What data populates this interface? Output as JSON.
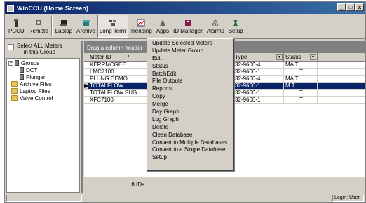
{
  "window": {
    "title": "WinCCU   (Home Screen)",
    "controls": [
      "_",
      "□",
      "x"
    ]
  },
  "toolbar": {
    "buttons": [
      {
        "label": "PCCU",
        "icon": "pccu-icon"
      },
      {
        "label": "Remote",
        "icon": "remote-icon"
      },
      {
        "label": "Laptop",
        "icon": "laptop-icon"
      },
      {
        "label": "Archive",
        "icon": "archive-icon"
      },
      {
        "label": "Long Term",
        "icon": "long-term-icon"
      },
      {
        "label": "Trending",
        "icon": "trending-icon"
      },
      {
        "label": "Apps",
        "icon": "apps-icon"
      },
      {
        "label": "ID Manager",
        "icon": "id-manager-icon"
      },
      {
        "label": "Alarms",
        "icon": "alarms-icon"
      },
      {
        "label": "Setup",
        "icon": "setup-icon"
      }
    ]
  },
  "sidebar": {
    "select_all_line1": "Select ALL Meters",
    "select_all_line2": "in this Group",
    "tree": [
      {
        "label": "Groups",
        "expander": "−"
      },
      {
        "label": "DCT"
      },
      {
        "label": "Plunger"
      },
      {
        "label": "Archive Files"
      },
      {
        "label": "Laptop Files"
      },
      {
        "label": "Valve Control"
      }
    ]
  },
  "grid": {
    "group_header": "Drag a column header",
    "columns": [
      "Meter ID",
      "",
      "Type",
      "Status"
    ],
    "sort_indicator": "/",
    "rows": [
      {
        "meter_id": "KERRMCGEE",
        "type": "32-9600-4",
        "status": "MA T"
      },
      {
        "meter_id": "LMC7100",
        "type": "32-9600-1",
        "status": "T"
      },
      {
        "meter_id": "PLUNG DEMO",
        "type": "32-9600-4",
        "status": "MA T"
      },
      {
        "meter_id": "TOTALFLOW",
        "type": "32-9600-1",
        "status": "M T",
        "selected": true,
        "indicator": "▶"
      },
      {
        "meter_id": "TOTALFLOW.SUG...",
        "type": "32-9600-1",
        "status": "T"
      },
      {
        "meter_id": "XFC7100",
        "type": "32-9600-1",
        "status": "T"
      }
    ],
    "count_label": "6 IDs"
  },
  "statusbar": {
    "login": "Login: User"
  },
  "long_term_menu": {
    "items": [
      "Update Selected Meters",
      "Update Meter Group",
      "Edit",
      "Status",
      "BatchEdit",
      "File Outputs",
      "Reports",
      "Copy",
      "Merge",
      "Day Graph",
      "Log Graph",
      "Delete",
      "Clean Database",
      "Convert to Multiple Databases",
      "Convert to a Single Database",
      "Setup"
    ]
  },
  "colors": {
    "titlebar": "#0a246a",
    "selection": "#0a246a",
    "face": "#d4d0c8"
  }
}
